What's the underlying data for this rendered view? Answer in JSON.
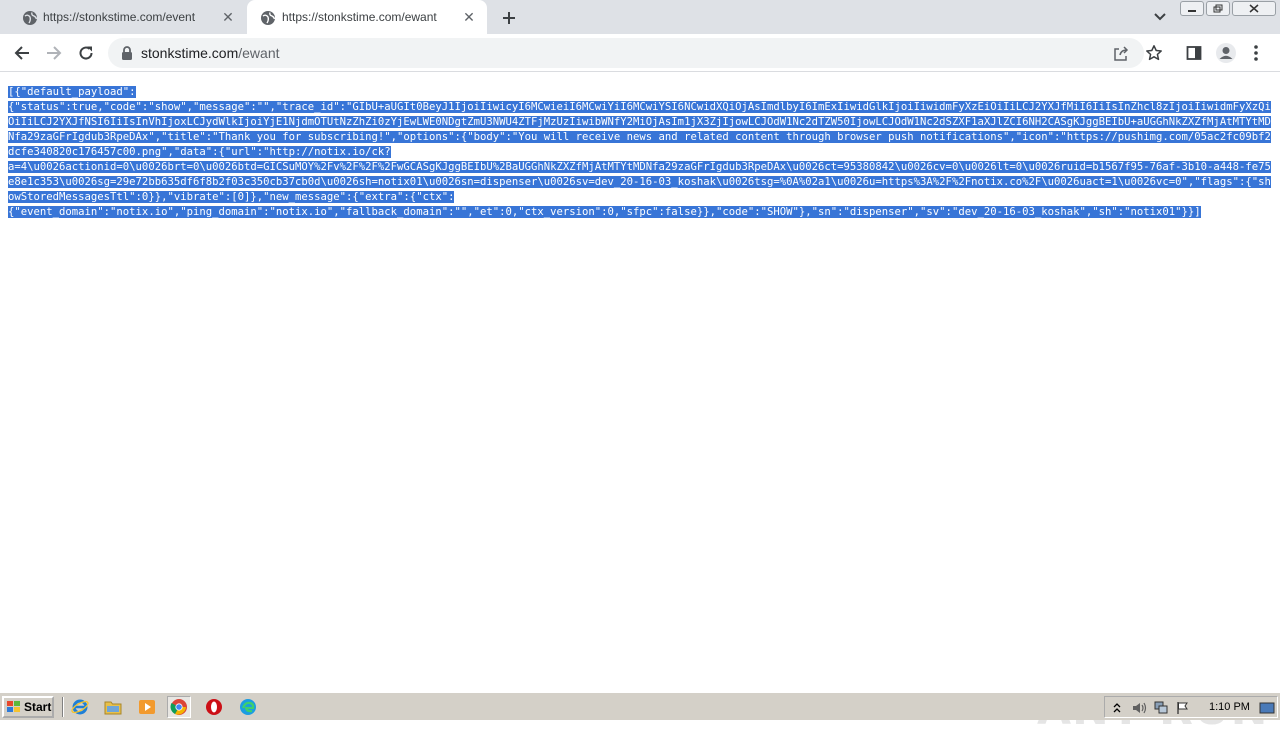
{
  "browser": {
    "tabs": [
      {
        "title": "https://stonkstime.com/event",
        "active": false
      },
      {
        "title": "https://stonkstime.com/ewant",
        "active": true
      }
    ],
    "address": {
      "host": "stonkstime.com",
      "path": "/ewant"
    }
  },
  "page": {
    "json_text": "[{\"default_payload\":\n{\"status\":true,\"code\":\"show\",\"message\":\"\",\"trace_id\":\"GIbU+aUGIt0BeyJ1IjoiIiwicyI6MCwieiI6MCwiYiI6MCwiYSI6NCwidXQiOjAsImdlbyI6ImExIiwidGlkIjoiIiwidmFyXzEiOiIiLCJ2YXJfMiI6IiIsInZhcl8zIjoiIiwidmFyXzQiOiIiLCJ2YXJfNSI6IiIsInVhIjoxLCJydWlkIjoiYjE1NjdmOTUtNzZhZi0zYjEwLWE0NDgtZmU3NWU4ZTFjMzUzIiwibWNfY2MiOjAsIm1jX3ZjIjowLCJOdW1Nc2dTZW50IjowLCJOdW1Nc2dSZXF1aXJlZCI6NH2CASgKJggBEIbU+aUGGhNkZXZfMjAtMTYtMDNfa29zaGFrIgdub3RpeDAx\",\"title\":\"Thank you for subscribing!\",\"options\":{\"body\":\"You will receive news and related content through browser push notifications\",\"icon\":\"https://pushimg.com/05ac2fc09bf2dcfe340820c176457c00.png\",\"data\":{\"url\":\"http://notix.io/ck?\na=4\\u0026actionid=0\\u0026brt=0\\u0026btd=GICSuMOY%2Fv%2F%2F%2FwGCASgKJggBEIbU%2BaUGGhNkZXZfMjAtMTYtMDNfa29zaGFrIgdub3RpeDAx\\u0026ct=95380842\\u0026cv=0\\u0026lt=0\\u0026ruid=b1567f95-76af-3b10-a448-fe75e8e1c353\\u0026sg=29e72bb635df6f8b2f03c350cb37cb0d\\u0026sh=notix01\\u0026sn=dispenser\\u0026sv=dev_20-16-03_koshak\\u0026tsg=%0A%02a1\\u0026u=https%3A%2F%2Fnotix.co%2F\\u0026uact=1\\u0026vc=0\",\"flags\":{\"showStoredMessagesTtl\":0}},\"vibrate\":[0]},\"new_message\":{\"extra\":{\"ctx\":\n{\"event_domain\":\"notix.io\",\"ping_domain\":\"notix.io\",\"fallback_domain\":\"\",\"et\":0,\"ctx_version\":0,\"sfpc\":false}},\"code\":\"SHOW\"},\"sn\":\"dispenser\",\"sv\":\"dev_20-16-03_koshak\",\"sh\":\"notix01\"}}]"
  },
  "watermark": "ANY RUN",
  "taskbar": {
    "start_label": "Start",
    "clock": "1:10 PM"
  },
  "colors": {
    "selection": "#3875d7",
    "tabstrip": "#dee1e6",
    "taskbar": "#d4d0c8"
  }
}
